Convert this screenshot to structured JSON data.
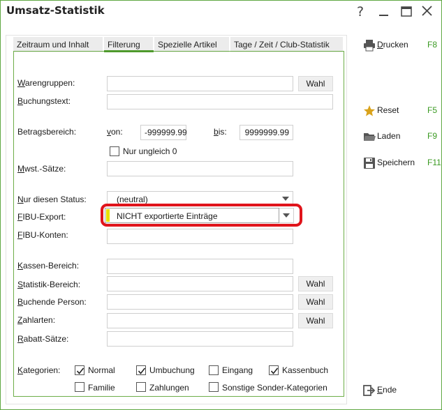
{
  "window": {
    "title": "Umsatz-Statistik"
  },
  "tabs": [
    {
      "label": "Zeitraum und Inhalt"
    },
    {
      "label": "Filterung"
    },
    {
      "label": "Spezielle Artikel"
    },
    {
      "label": "Tage / Zeit / Club-Statistik"
    }
  ],
  "active_tab": "Filterung",
  "form": {
    "warengruppen": {
      "label_u": "W",
      "label_rest": "arengruppen:",
      "value": "",
      "button": "Wahl"
    },
    "buchungstext": {
      "label_u": "B",
      "label_rest": "uchungstext:",
      "value": ""
    },
    "betragsbereich": {
      "label": "Betragsbereich:",
      "von_u": "v",
      "von_rest": "on:",
      "von_value": "-999999.99",
      "bis_u": "b",
      "bis_rest": "is:",
      "bis_value": "9999999.99"
    },
    "nur_ungleich": {
      "label": "Nur ungleich 0",
      "checked": false
    },
    "mwst": {
      "label_u": "M",
      "label_rest": "wst.-Sätze:",
      "value": ""
    },
    "status": {
      "label_u": "N",
      "label_rest": "ur diesen Status:",
      "value": "(neutral)"
    },
    "fibu_export": {
      "label_u": "F",
      "label_rest": "IBU-Export:",
      "value": "NICHT exportierte Einträge"
    },
    "fibu_konten": {
      "label_u": "F",
      "label_rest": "IBU-Konten:",
      "value": ""
    },
    "kassen_bereich": {
      "label_u": "K",
      "label_rest": "assen-Bereich:",
      "value": ""
    },
    "statistik_bereich": {
      "label_u": "S",
      "label_rest": "tatistik-Bereich:",
      "value": "",
      "button": "Wahl"
    },
    "buchende_person": {
      "label_u": "B",
      "label_rest": "uchende Person:",
      "value": "",
      "button": "Wahl"
    },
    "zahlarten": {
      "label_u": "Z",
      "label_rest": "ahlarten:",
      "value": "",
      "button": "Wahl"
    },
    "rabatt": {
      "label_u": "R",
      "label_rest": "abatt-Sätze:",
      "value": ""
    },
    "kategorien": {
      "label_u": "K",
      "label_rest": "ategorien:",
      "items": [
        {
          "label": "Normal",
          "checked": true
        },
        {
          "label": "Umbuchung",
          "checked": true
        },
        {
          "label": "Eingang",
          "checked": false
        },
        {
          "label": "Kassenbuch",
          "checked": true
        },
        {
          "label": "Familie",
          "checked": false
        },
        {
          "label": "Zahlungen",
          "checked": false
        },
        {
          "label": "Sonstige Sonder-Kategorien",
          "checked": false
        }
      ]
    }
  },
  "sidebar": {
    "drucken": {
      "label_u": "D",
      "label_rest": "rucken",
      "key": "F8",
      "icon": "printer-icon"
    },
    "reset": {
      "label": "Reset",
      "key": "F5",
      "icon": "star-icon"
    },
    "laden": {
      "label": "Laden",
      "key": "F9",
      "icon": "folder-icon"
    },
    "speichern": {
      "label": "Speichern",
      "key": "F11",
      "icon": "floppy-icon"
    },
    "ende": {
      "label_u": "E",
      "label_rest": "nde",
      "icon": "exit-icon"
    }
  },
  "colors": {
    "accent": "#6dae48",
    "highlight": "#e0141b",
    "status_bar_yellow": "#e8e200",
    "shortcut_key": "#3a9a22"
  }
}
